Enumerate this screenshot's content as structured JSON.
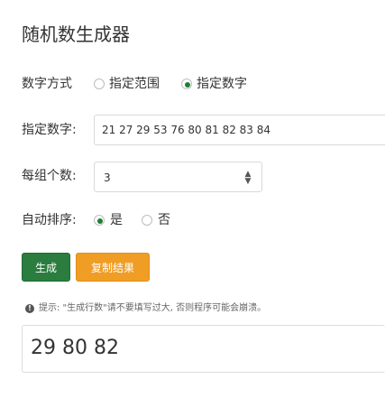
{
  "title": "随机数生成器",
  "mode": {
    "label": "数字方式",
    "options": [
      {
        "label": "指定范围",
        "checked": false
      },
      {
        "label": "指定数字",
        "checked": true
      }
    ]
  },
  "numbers": {
    "label": "指定数字:",
    "value": "21 27 29 53 76 80 81 82 83 84"
  },
  "per_group": {
    "label": "每组个数:",
    "value": "3"
  },
  "auto_sort": {
    "label": "自动排序:",
    "options": [
      {
        "label": "是",
        "checked": true
      },
      {
        "label": "否",
        "checked": false
      }
    ]
  },
  "buttons": {
    "generate": "生成",
    "copy": "复制结果"
  },
  "hint": "提示: \"生成行数\"请不要填写过大, 否则程序可能会崩溃。",
  "hint_icon": "info-icon",
  "result": "29 80 82",
  "colors": {
    "green": "#2a7d3f",
    "orange": "#ef9d24",
    "radio_checked": "#1e7e34"
  }
}
